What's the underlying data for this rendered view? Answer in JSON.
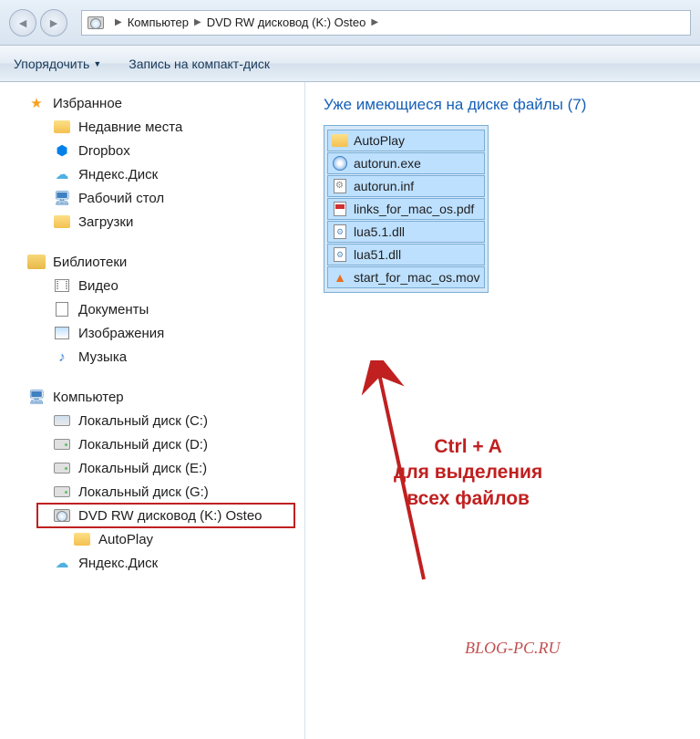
{
  "nav": {
    "breadcrumb": [
      "Компьютер",
      "DVD RW дисковод (K:) Osteo"
    ]
  },
  "toolbar": {
    "organize": "Упорядочить",
    "burn": "Запись на компакт-диск"
  },
  "sidebar": {
    "favorites": "Избранное",
    "fav_items": [
      "Недавние места",
      "Dropbox",
      "Яндекс.Диск",
      "Рабочий стол",
      "Загрузки"
    ],
    "libraries": "Библиотеки",
    "lib_items": [
      "Видео",
      "Документы",
      "Изображения",
      "Музыка"
    ],
    "computer": "Компьютер",
    "drives": [
      "Локальный диск (C:)",
      "Локальный диск (D:)",
      "Локальный диск (E:)",
      "Локальный диск (G:)",
      "DVD RW дисковод (K:) Osteo",
      "AutoPlay",
      "Яндекс.Диск"
    ]
  },
  "content": {
    "header": "Уже имеющиеся на диске файлы (7)",
    "files": [
      {
        "name": "AutoPlay",
        "icon": "folder"
      },
      {
        "name": "autorun.exe",
        "icon": "exe"
      },
      {
        "name": "autorun.inf",
        "icon": "inf"
      },
      {
        "name": "links_for_mac_os.pdf",
        "icon": "pdf"
      },
      {
        "name": "lua5.1.dll",
        "icon": "dll"
      },
      {
        "name": "lua51.dll",
        "icon": "dll"
      },
      {
        "name": "start_for_mac_os.mov",
        "icon": "mov"
      }
    ]
  },
  "annotation": {
    "line1": "Ctrl + A",
    "line2": "для выделения",
    "line3": "всех файлов"
  },
  "watermark": "BLOG-PC.RU"
}
